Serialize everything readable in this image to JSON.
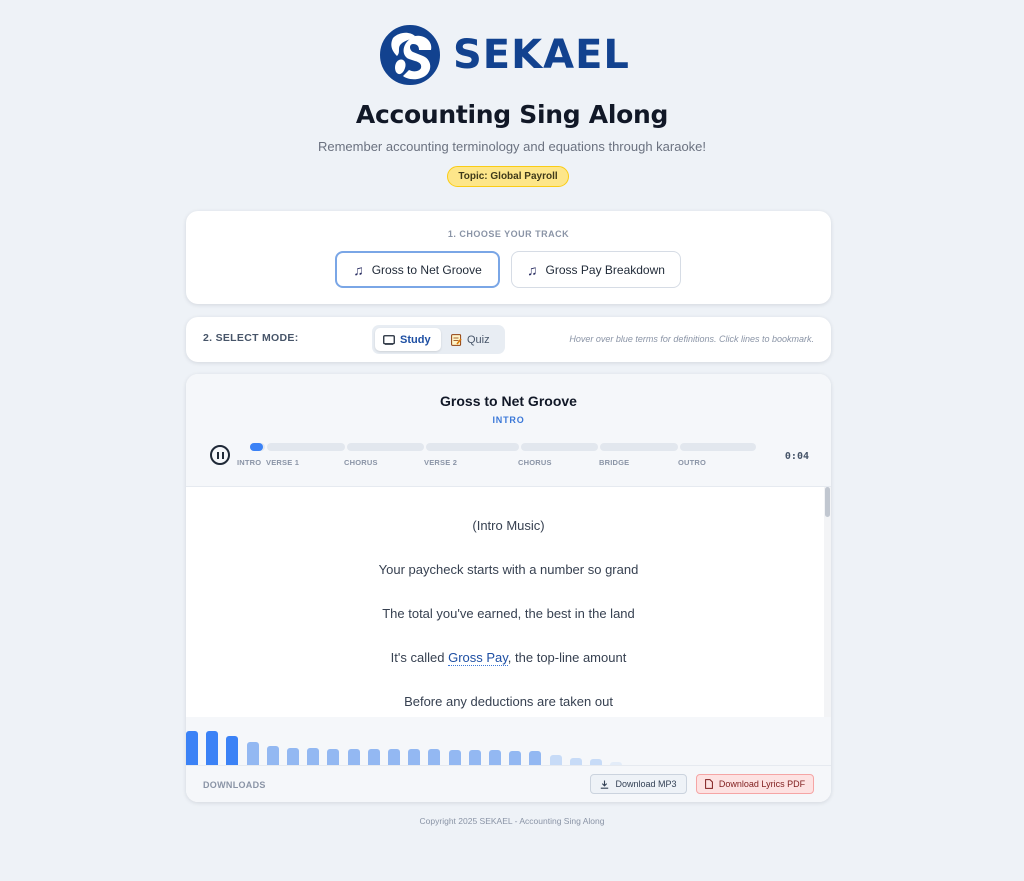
{
  "brand": {
    "name": "SEKAEL",
    "color": "#12428f"
  },
  "header": {
    "title": "Accounting Sing Along",
    "subtitle": "Remember accounting terminology and equations through karaoke!",
    "topic_badge": "Topic: Global Payroll"
  },
  "track_selector": {
    "label": "1. CHOOSE YOUR TRACK",
    "tracks": [
      {
        "label": "Gross to Net Groove",
        "icon": "music-note-icon",
        "selected": true
      },
      {
        "label": "Gross Pay Breakdown",
        "icon": "music-note-icon",
        "selected": false
      }
    ]
  },
  "mode_selector": {
    "label": "2. SELECT MODE:",
    "options": [
      {
        "label": "Study",
        "icon": "book-icon",
        "selected": true
      },
      {
        "label": "Quiz",
        "icon": "memo-icon",
        "selected": false
      }
    ],
    "hint": "Hover over blue terms for definitions. Click lines to bookmark."
  },
  "player": {
    "song_title": "Gross to Net Groove",
    "current_section": "INTRO",
    "time": "0:04",
    "playing": true,
    "sections": [
      "INTRO",
      "VERSE 1",
      "CHORUS",
      "VERSE 2",
      "CHORUS",
      "BRIDGE",
      "OUTRO"
    ],
    "progress_fraction": 0.02
  },
  "lyrics": {
    "lines": [
      {
        "text": "(Intro Music)"
      },
      {
        "text": "Your paycheck starts with a number so grand"
      },
      {
        "text": "The total you've earned, the best in the land"
      },
      {
        "before": "It's called ",
        "term": "Gross Pay",
        "after": ", the top-line amount"
      },
      {
        "text": "Before any deductions are taken out"
      }
    ]
  },
  "visualizer": {
    "levels": [
      1.0,
      1.0,
      0.85,
      0.68,
      0.55,
      0.5,
      0.5,
      0.48,
      0.48,
      0.48,
      0.48,
      0.46,
      0.46,
      0.44,
      0.44,
      0.44,
      0.42,
      0.42,
      0.28,
      0.22,
      0.18,
      0.08
    ],
    "colors": {
      "loud": "#3b82f6",
      "mid": "#93b8f2",
      "quiet": "#c7dbf7",
      "faint": "#e3ecf8"
    }
  },
  "downloads": {
    "label": "DOWNLOADS",
    "mp3_label": "Download MP3",
    "pdf_label": "Download Lyrics PDF"
  },
  "footer": {
    "copyright": "Copyright 2025 SEKAEL - Accounting Sing Along"
  }
}
